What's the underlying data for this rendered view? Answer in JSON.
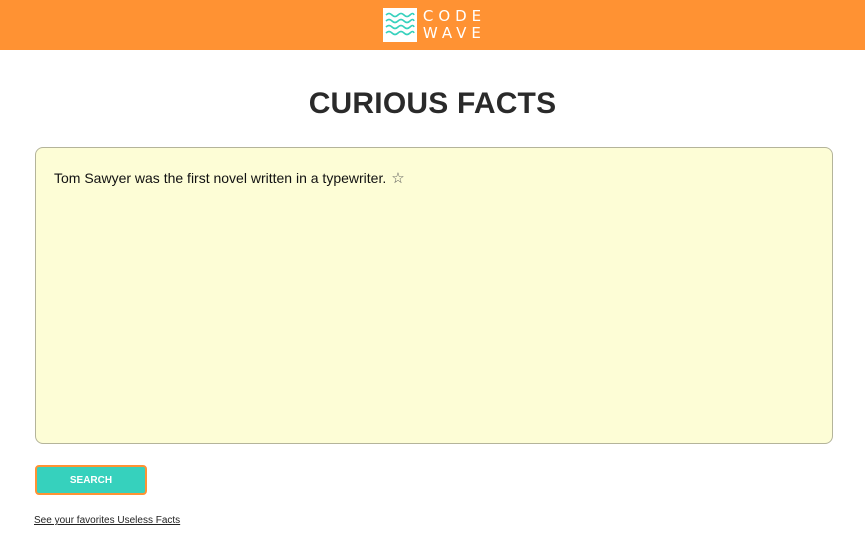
{
  "header": {
    "logo_word_1": "CODE",
    "logo_word_2": "WAVE",
    "logo_icon": "wave-icon",
    "background_color": "#ff9233"
  },
  "main": {
    "title": "CURIOUS FACTS",
    "fact_text": "Tom Sawyer was the first novel written in a typewriter.",
    "favorite_icon": "star-outline-icon",
    "favorite_glyph": "☆",
    "fact_box_color": "#fdfdd6"
  },
  "actions": {
    "search_label": "SEARCH",
    "search_button_color": "#36d1bd",
    "favorites_link": "See your favorites Useless Facts"
  }
}
